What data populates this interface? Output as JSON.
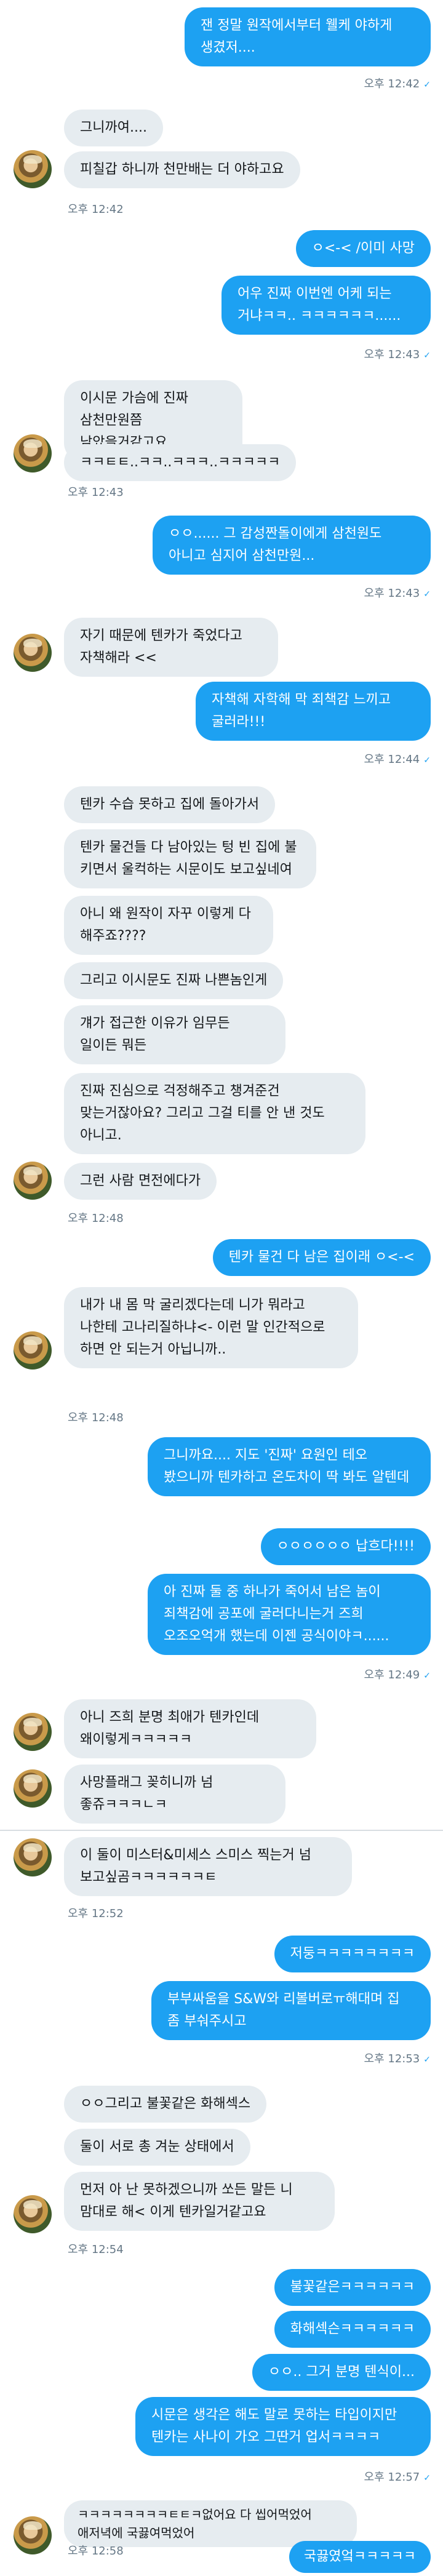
{
  "messages": [
    {
      "side": "out",
      "text": "잰 정말 원작에서부터 웰케 야하게 생겼저...."
    },
    {
      "side": "meta",
      "text": "오후 12:42",
      "check": "✓"
    },
    {
      "side": "in",
      "text": "그니까여...."
    },
    {
      "side": "in",
      "text": "피칠갑 하니까 천만배는 더 야하고요"
    },
    {
      "side": "meta",
      "text": "오후 12:42"
    },
    {
      "side": "out",
      "text": "ㅇ<-< /이미 사망"
    },
    {
      "side": "out",
      "text": "어우 진짜 이번엔 어케 되는 거냐ㅋㅋ.. ㅋㅋㅋㅋㅋㅋ......"
    },
    {
      "side": "meta",
      "text": "오후 12:43",
      "check": "✓"
    },
    {
      "side": "in",
      "text": "이시문 가슴에 진짜 삼천만원쯤 남았을거같고요"
    },
    {
      "side": "in",
      "text": "ㅋㅋㅌㅌ..ㅋㅋ..ㅋㅋㅋ..ㅋㅋㅋㅋㅋ"
    },
    {
      "side": "meta",
      "text": "오후 12:43"
    },
    {
      "side": "out",
      "text": "ㅇㅇ...... 그 감성짠돌이에게 삼천원도 아니고 심지어 삼천만원..."
    },
    {
      "side": "meta",
      "text": "오후 12:43",
      "check": "✓"
    },
    {
      "side": "in",
      "text": "자기 때문에 텐카가 죽었다고 자책해라 <<"
    },
    {
      "side": "out",
      "text": "자책해 자학해 막 죄책감 느끼고 굴러라!!!"
    },
    {
      "side": "meta",
      "text": "오후 12:44",
      "check": "✓"
    },
    {
      "side": "in",
      "text": "텐카 수습 못하고 집에 돌아가서"
    },
    {
      "side": "in",
      "text": "텐카 물건들 다 남아있는 텅 빈 집에 불 키면서 울컥하는 시문이도 보고싶네여"
    },
    {
      "side": "in",
      "text": "아니 왜 원작이 자꾸 이렇게 다 해주죠????"
    },
    {
      "side": "in",
      "text": "그리고 이시문도 진짜 나쁜놈인게"
    },
    {
      "side": "in",
      "text": "걔가 접근한 이유가 임무든 일이든 뭐든"
    },
    {
      "side": "in",
      "text": "진짜 진심으로 걱정해주고 챙겨준건 맞는거잖아요? 그리고 그걸 티를 안 낸 것도 아니고."
    },
    {
      "side": "in",
      "text": "그런 사람 면전에다가"
    },
    {
      "side": "meta",
      "text": "오후 12:48"
    },
    {
      "side": "out",
      "text": "텐카 물건 다 남은 집이래 ㅇ<-<"
    },
    {
      "side": "in",
      "text": "내가 내 몸 막 굴리겠다는데 니가 뭐라고  나한테 고나리질하냐<- 이런 말 인간적으로 하면 안 되는거 아닙니까.."
    },
    {
      "side": "meta",
      "text": "오후 12:48"
    },
    {
      "side": "out",
      "text": "그니까요.... 지도 '진짜' 요원인 테오 봤으니까 텐카하고 온도차이 딱 봐도 알텐데"
    },
    {
      "side": "out",
      "text": "ㅇㅇㅇㅇㅇㅇ 납흐다!!!!"
    },
    {
      "side": "out",
      "text": "아 진짜 둘 중 하나가 죽어서 남은 놈이 죄책감에 공포에 굴러다니는거 즈희 오조오억개 했는데 이젠 공식이야ㅋ......"
    },
    {
      "side": "meta",
      "text": "오후 12:49",
      "check": "✓"
    },
    {
      "side": "in",
      "text": "아니 즈희 분명 최애가 텐카인데 왜이렇게ㅋㅋㅋㅋㅋ"
    },
    {
      "side": "in",
      "text": "사망플래그 꽂히니까 넘 좋쥬ㅋㅋㅋㄴㅋ"
    },
    {
      "side": "in",
      "text": "이 둘이 미스터&미세스 스미스 찍는거 넘 보고싶곰ㅋㅋㅋㅋㅋㅋㅌ"
    },
    {
      "side": "meta",
      "text": "오후 12:52"
    },
    {
      "side": "out",
      "text": "저둥ㅋㅋㅋㅋㅋㅋㅋㅋ"
    },
    {
      "side": "out",
      "text": "부부싸움을 S&W와 리볼버로ㅠ해대며 집 좀 부숴주시고"
    },
    {
      "side": "meta",
      "text": "오후 12:53",
      "check": "✓"
    },
    {
      "side": "in",
      "text": "ㅇㅇ그리고 불꽃같은 화해섹스"
    },
    {
      "side": "in",
      "text": "둘이 서로 총 겨눈 상태에서"
    },
    {
      "side": "in",
      "text": "먼저 아 난 못하겠으니까 쏘든 말든 니 맘대로 해< 이게 텐카일거같고요"
    },
    {
      "side": "meta",
      "text": "오후 12:54"
    },
    {
      "side": "out",
      "text": "불꽃같은ㅋㅋㅋㅋㅋㅋ"
    },
    {
      "side": "out",
      "text": "화해섹슨ㅋㅋㅋㅋㅋㅋ"
    },
    {
      "side": "out",
      "text": "ㅇㅇ.. 그거 분명 텐식이..."
    },
    {
      "side": "out",
      "text": "시문은 생각은 해도 말로 못하는 타입이지만 텐카는 사나이 가오 그딴거 업서ㅋㅋㅋㅋ"
    },
    {
      "side": "meta",
      "text": "오후 12:57",
      "check": "✓"
    },
    {
      "side": "in",
      "text": "ㅋㅋㅋㅋㅋㅋㅋㅋㅌㅌㅋ없어요 다 씹어먹었어 애저녁에 국끓여먹었어"
    },
    {
      "side": "meta",
      "text": "오후 12:58"
    },
    {
      "side": "out",
      "text": "국끓였엌ㅋㅋㅋㅋㅋ"
    }
  ]
}
